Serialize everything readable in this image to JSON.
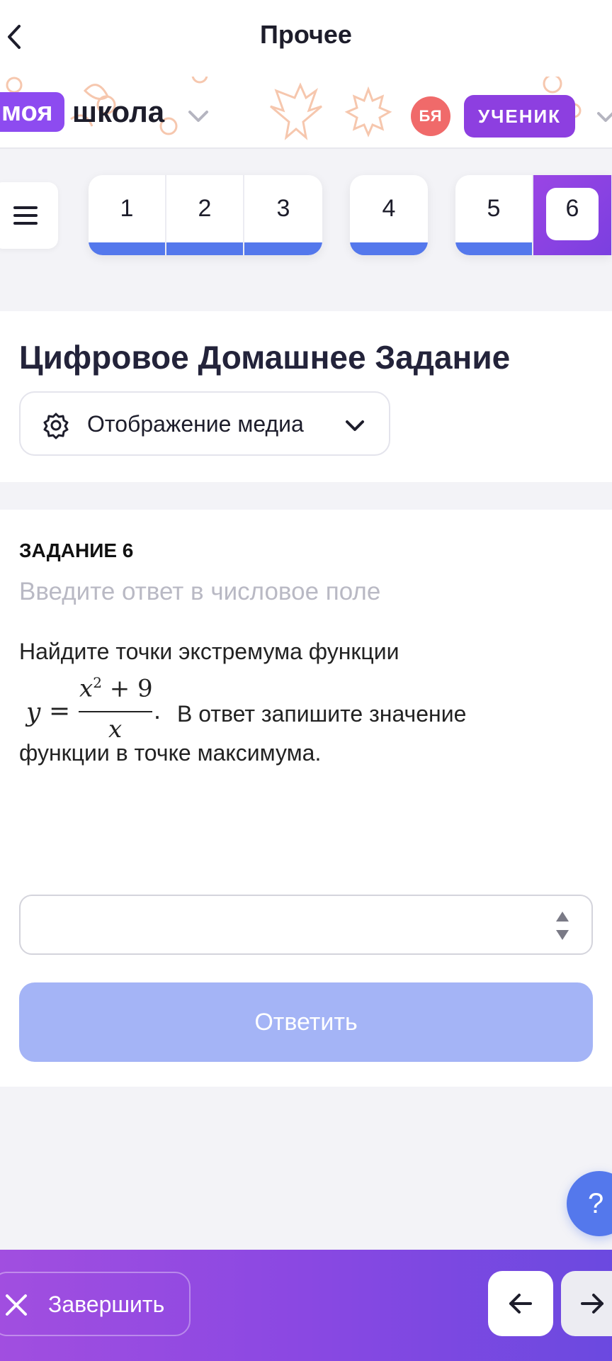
{
  "header": {
    "title": "Прочее"
  },
  "brand": {
    "logo_highlight": "моя",
    "logo_text": "школа",
    "avatar_initials": "БЯ",
    "role": "УЧЕНИК"
  },
  "pager": {
    "items": [
      "1",
      "2",
      "3",
      "4",
      "5",
      "6"
    ],
    "active": "6"
  },
  "homework": {
    "title": "Цифровое Домашнее Задание",
    "media_toggle_label": "Отображение медиа"
  },
  "task": {
    "heading": "ЗАДАНИЕ 6",
    "hint": "Введите ответ в числовое поле",
    "text_line1": "Найдите точки экстремума функции",
    "formula": {
      "lhs": "y",
      "eq": "=",
      "numerator_base": "x",
      "numerator_exp": "2",
      "numerator_rest": " + 9",
      "denominator": "x",
      "dot": "."
    },
    "text_line2_rest": "В ответ запишите значение",
    "text_line3": "функции в точке максимума.",
    "answer_value": "",
    "submit_label": "Ответить"
  },
  "help": {
    "label": "?"
  },
  "footer": {
    "finish_label": "Завершить"
  },
  "colors": {
    "accent_blue": "#5478ec",
    "accent_purple": "#8d3fe0",
    "submit_disabled": "#a4b4f6",
    "avatar": "#f06a6a"
  },
  "icons": {
    "back": "chevron-left-icon",
    "brand_menu": "chevron-down-icon",
    "role_menu": "chevron-down-icon",
    "menu": "hamburger-icon",
    "media_settings": "gear-icon",
    "media_expand": "chevron-down-icon",
    "spinner": "stepper-icon",
    "finish": "close-icon",
    "prev": "arrow-left-icon",
    "next": "arrow-right-icon"
  }
}
